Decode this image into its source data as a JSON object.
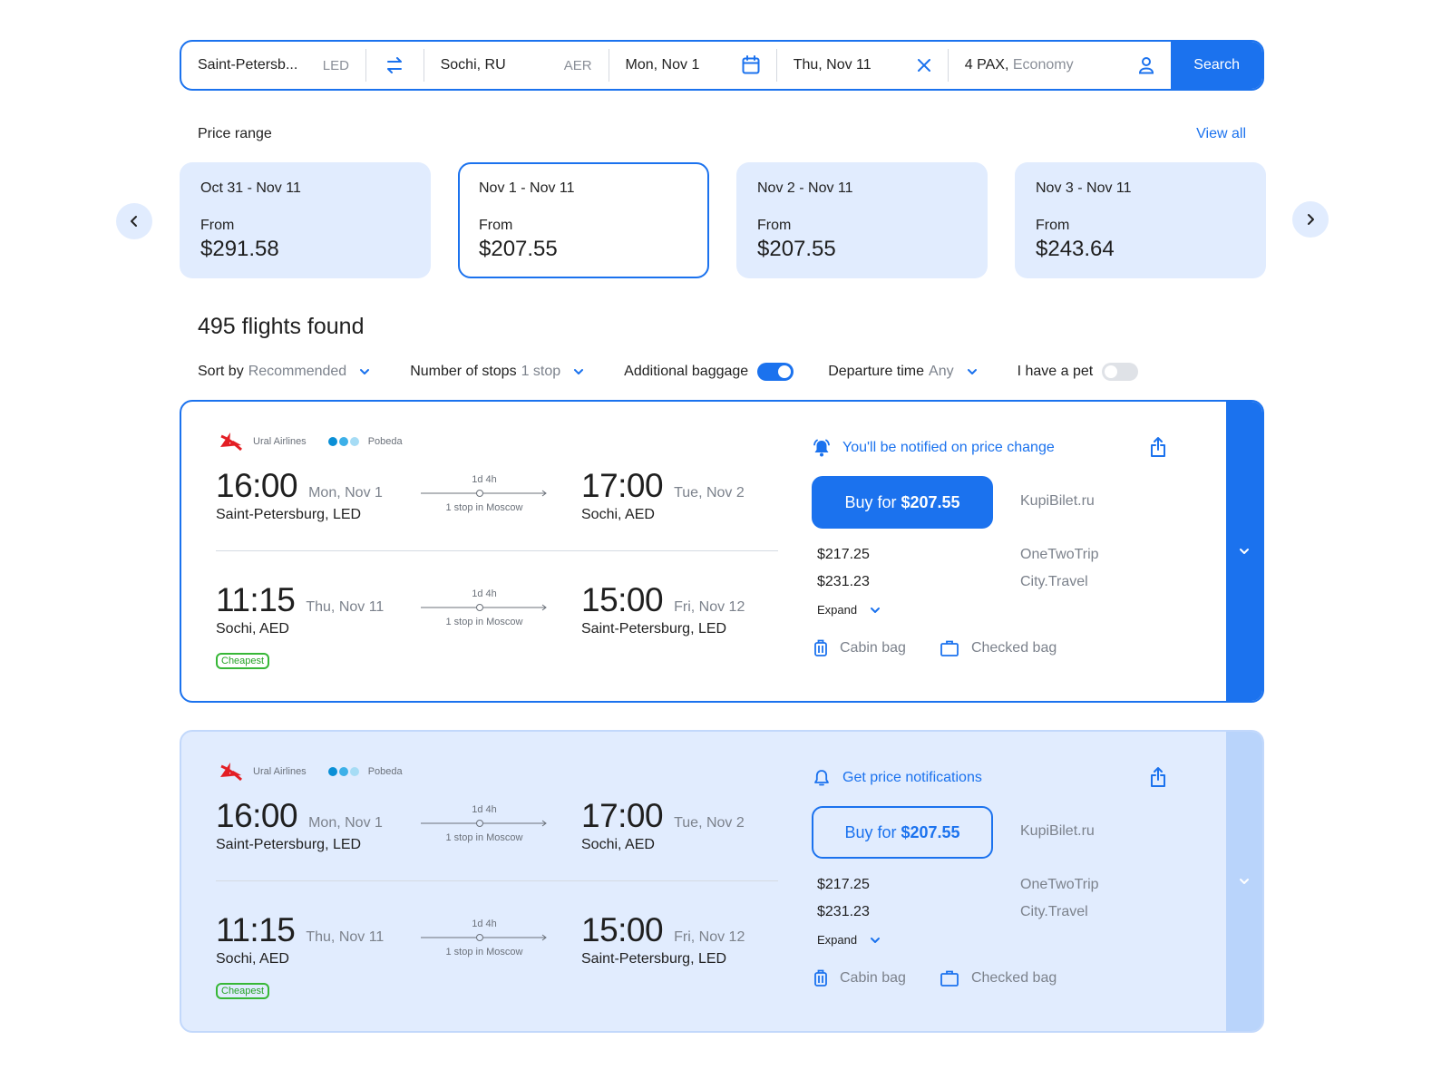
{
  "search": {
    "from_city": "Saint-Petersb...",
    "from_code": "LED",
    "to_city": "Sochi, RU",
    "to_code": "AER",
    "depart_date": "Mon, Nov 1",
    "return_date": "Thu, Nov 11",
    "pax": "4 PAX,",
    "cabin_class": "Economy",
    "search_label": "Search",
    "icons": {
      "swap": "swap-arrows-icon",
      "calendar": "calendar-icon",
      "clear": "close-icon",
      "passenger": "user-icon"
    },
    "accent_color": "#1b72ee"
  },
  "price_range": {
    "title": "Price range",
    "view_all_label": "View all",
    "cards": [
      {
        "dates": "Oct 31 - Nov 11",
        "from_label": "From",
        "price": "$291.58",
        "selected": false
      },
      {
        "dates": "Nov 1 - Nov 11",
        "from_label": "From",
        "price": "$207.55",
        "selected": true
      },
      {
        "dates": "Nov 2 - Nov 11",
        "from_label": "From",
        "price": "$207.55",
        "selected": false
      },
      {
        "dates": "Nov 3 - Nov 11",
        "from_label": "From",
        "price": "$243.64",
        "selected": false
      }
    ]
  },
  "results": {
    "count_label": "495 flights found",
    "filters": {
      "sort": {
        "label": "Sort by",
        "value": "Recommended"
      },
      "stops": {
        "label": "Number of stops",
        "value": "1 stop"
      },
      "baggage": {
        "label": "Additional baggage",
        "enabled": true
      },
      "departure": {
        "label": "Departure time",
        "value": "Any"
      },
      "pet": {
        "label": "I have a pet",
        "enabled": false
      }
    }
  },
  "flights": [
    {
      "state": "active",
      "airlines": [
        {
          "name": "Ural Airlines",
          "logo": "ural-airlines-logo"
        },
        {
          "name": "Pobeda",
          "logo": "pobeda-logo"
        }
      ],
      "outbound": {
        "dep_time": "16:00",
        "dep_date": "Mon, Nov 1",
        "dep_place": "Saint-Petersburg, LED",
        "duration": "1d 4h",
        "stops": "1 stop in Moscow",
        "arr_time": "17:00",
        "arr_date": "Tue, Nov 2",
        "arr_place": "Sochi, AED"
      },
      "return": {
        "dep_time": "11:15",
        "dep_date": "Thu, Nov 11",
        "dep_place": "Sochi, AED",
        "duration": "1d 4h",
        "stops": "1 stop in Moscow",
        "arr_time": "15:00",
        "arr_date": "Fri, Nov 12",
        "arr_place": "Saint-Petersburg, LED"
      },
      "badge": "Cheapest",
      "notify_label": "You'll be notified on price change",
      "notify_icon": "bell-ringing-icon",
      "buy_prefix": "Buy for",
      "buy_price": "$207.55",
      "main_vendor": "KupiBilet.ru",
      "alt_offers": [
        {
          "price": "$217.25",
          "vendor": "OneTwoTrip"
        },
        {
          "price": "$231.23",
          "vendor": "City.Travel"
        }
      ],
      "expand_label": "Expand",
      "bags": {
        "cabin": "Cabin bag",
        "checked": "Checked bag"
      }
    },
    {
      "state": "inactive",
      "airlines": [
        {
          "name": "Ural Airlines",
          "logo": "ural-airlines-logo"
        },
        {
          "name": "Pobeda",
          "logo": "pobeda-logo"
        }
      ],
      "outbound": {
        "dep_time": "16:00",
        "dep_date": "Mon, Nov 1",
        "dep_place": "Saint-Petersburg, LED",
        "duration": "1d 4h",
        "stops": "1 stop in Moscow",
        "arr_time": "17:00",
        "arr_date": "Tue, Nov 2",
        "arr_place": "Sochi, AED"
      },
      "return": {
        "dep_time": "11:15",
        "dep_date": "Thu, Nov 11",
        "dep_place": "Sochi, AED",
        "duration": "1d 4h",
        "stops": "1 stop in Moscow",
        "arr_time": "15:00",
        "arr_date": "Fri, Nov 12",
        "arr_place": "Saint-Petersburg, LED"
      },
      "badge": "Cheapest",
      "notify_label": "Get price notifications",
      "notify_icon": "bell-icon",
      "buy_prefix": "Buy for",
      "buy_price": "$207.55",
      "main_vendor": "KupiBilet.ru",
      "alt_offers": [
        {
          "price": "$217.25",
          "vendor": "OneTwoTrip"
        },
        {
          "price": "$231.23",
          "vendor": "City.Travel"
        }
      ],
      "expand_label": "Expand",
      "bags": {
        "cabin": "Cabin bag",
        "checked": "Checked bag"
      }
    }
  ]
}
